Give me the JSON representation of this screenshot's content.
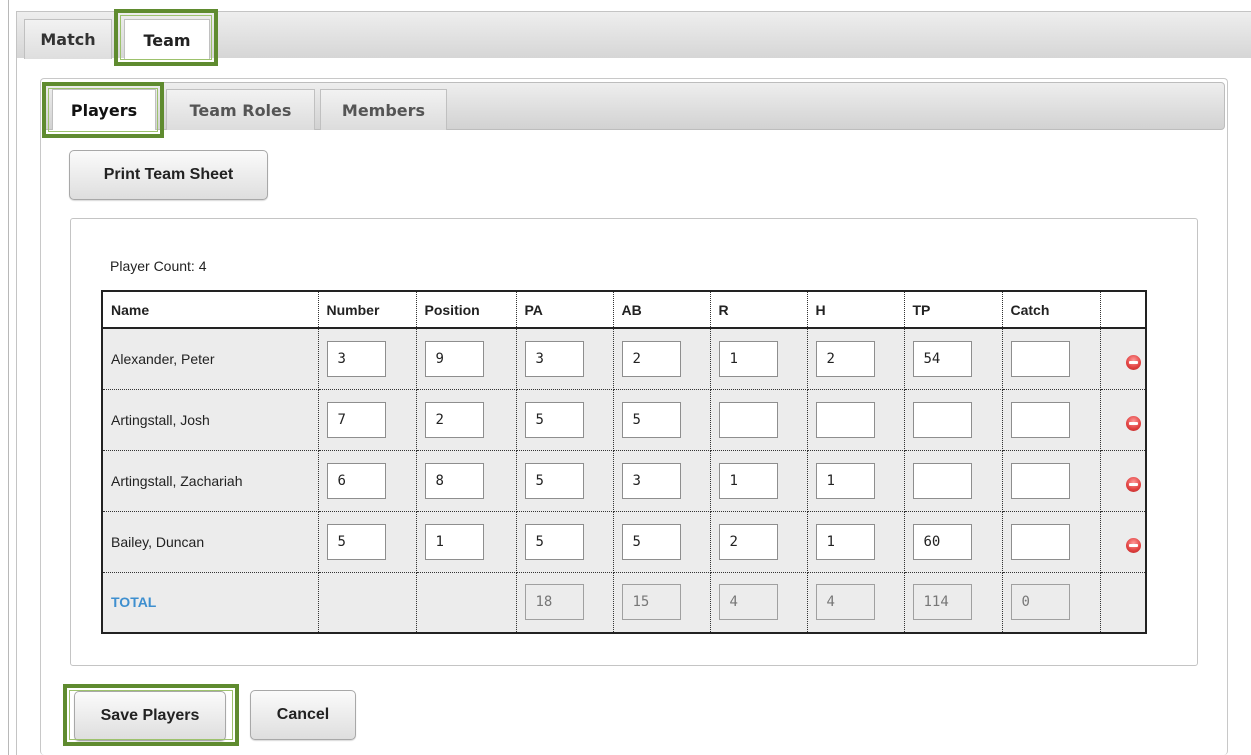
{
  "outer_tabs": [
    {
      "label": "Match",
      "active": false
    },
    {
      "label": "Team",
      "active": true
    }
  ],
  "inner_tabs": [
    {
      "label": "Players",
      "active": true
    },
    {
      "label": "Team Roles",
      "active": false
    },
    {
      "label": "Members",
      "active": false
    }
  ],
  "print_button": "Print Team Sheet",
  "player_count": "Player Count: 4",
  "columns": [
    "Name",
    "Number",
    "Position",
    "PA",
    "AB",
    "R",
    "H",
    "TP",
    "Catch",
    ""
  ],
  "players": [
    {
      "name": "Alexander, Peter",
      "values": [
        "3",
        "9",
        "3",
        "2",
        "1",
        "2",
        "54",
        ""
      ]
    },
    {
      "name": "Artingstall, Josh",
      "values": [
        "7",
        "2",
        "5",
        "5",
        "",
        "",
        "",
        ""
      ]
    },
    {
      "name": "Artingstall, Zachariah",
      "values": [
        "6",
        "8",
        "5",
        "3",
        "1",
        "1",
        "",
        ""
      ]
    },
    {
      "name": "Bailey, Duncan",
      "values": [
        "5",
        "1",
        "5",
        "5",
        "2",
        "1",
        "60",
        ""
      ]
    }
  ],
  "total": {
    "label": "TOTAL",
    "values": [
      "18",
      "15",
      "4",
      "4",
      "114",
      "0"
    ]
  },
  "save_button": "Save Players",
  "cancel_button": "Cancel",
  "colors": {
    "highlight": "#5f8b2f",
    "total_label": "#3e8fcf",
    "remove_icon": "#e0403f"
  },
  "icons": {
    "remove": "remove-circle-icon"
  }
}
